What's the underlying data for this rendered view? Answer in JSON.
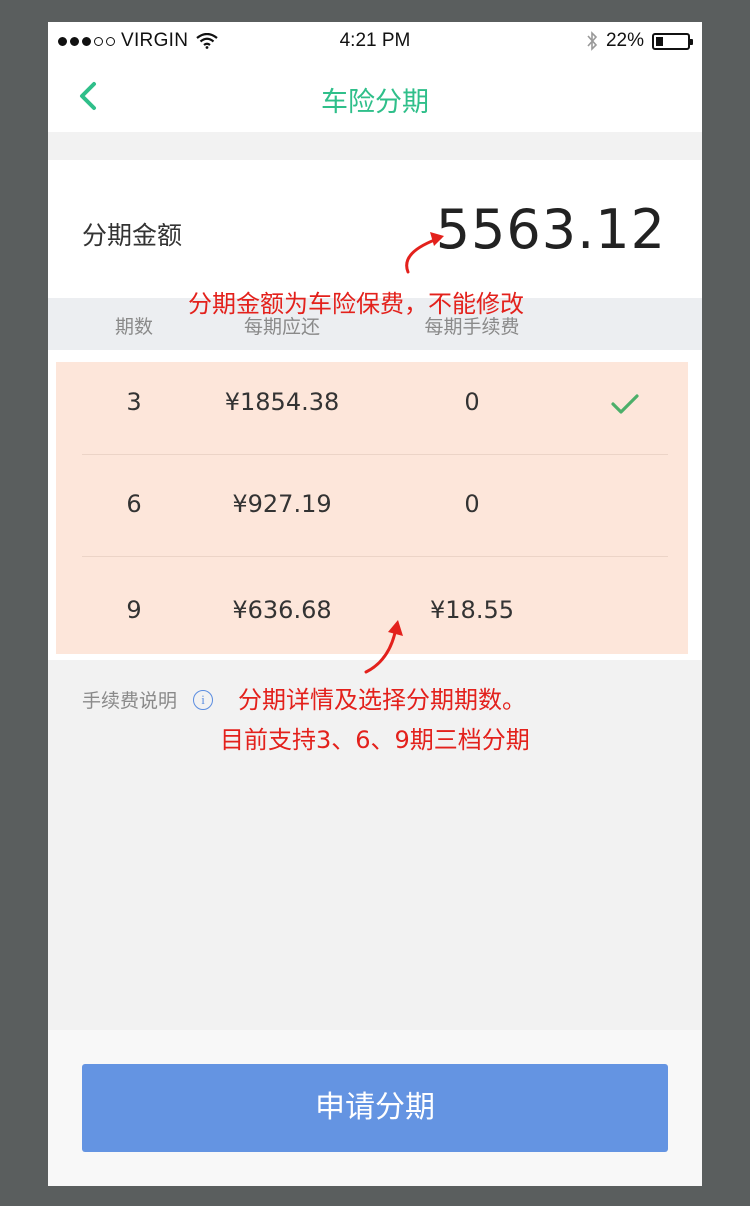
{
  "status_bar": {
    "carrier": "VIRGIN",
    "time": "4:21 PM",
    "battery_text": "22%",
    "battery_level": 0.22,
    "signal_bars_filled": 3,
    "signal_bars_total": 5
  },
  "nav": {
    "title": "车险分期",
    "back_icon": "chevron-left-icon",
    "accent_color": "#2fbf8a"
  },
  "amount": {
    "label": "分期金额",
    "value": "5563.12"
  },
  "table": {
    "headers": [
      "期数",
      "每期应还",
      "每期手续费"
    ],
    "rows": [
      {
        "periods": "3",
        "payment": "¥1854.38",
        "fee": "0",
        "selected": true
      },
      {
        "periods": "6",
        "payment": "¥927.19",
        "fee": "0",
        "selected": false
      },
      {
        "periods": "9",
        "payment": "¥636.68",
        "fee": "¥18.55",
        "selected": false
      }
    ],
    "check_icon": "check-icon",
    "row_highlight_color": "#fde6da"
  },
  "fee_info": {
    "label": "手续费说明",
    "icon": "info-icon",
    "icon_glyph": "i"
  },
  "apply_button": {
    "label": "申请分期",
    "color": "#6494e2"
  },
  "annotations": {
    "amount_note": "分期金额为车险保费，不能修改",
    "detail_note_1": "分期详情及选择分期期数。",
    "detail_note_2": "目前支持3、6、9期三档分期",
    "color": "#e3211c"
  }
}
